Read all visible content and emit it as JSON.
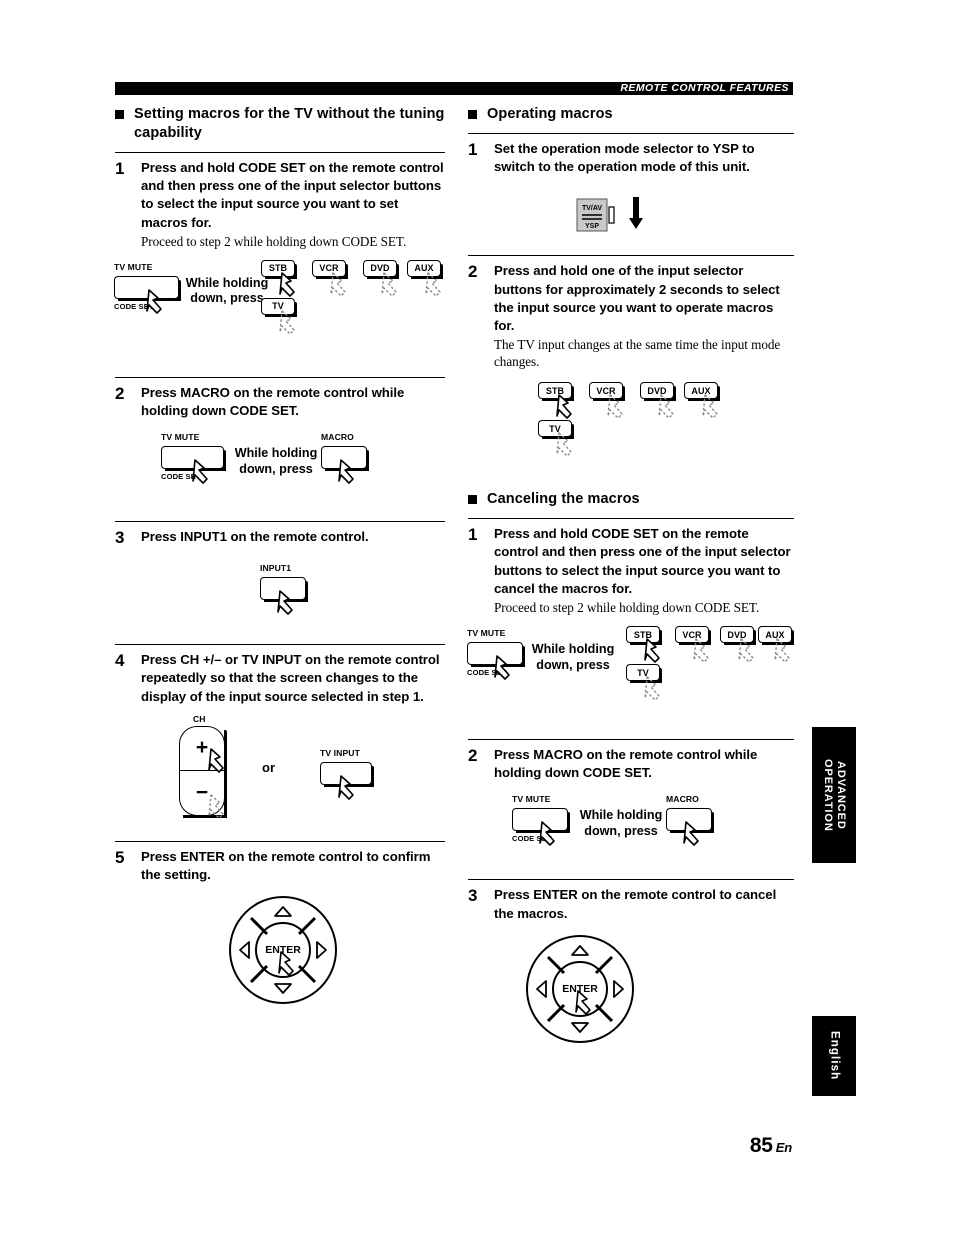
{
  "header": {
    "running_title": "REMOTE CONTROL FEATURES"
  },
  "labels": {
    "while_holding_line1": "While holding",
    "while_holding_line2": "down, press",
    "or": "or",
    "tv_mute": "TV MUTE",
    "code_set": "CODE SET",
    "macro": "MACRO",
    "input1": "INPUT1",
    "ch": "CH",
    "plus": "+",
    "minus": "−",
    "tv_input": "TV INPUT",
    "enter": "ENTER",
    "selector_top": "TV/AV",
    "selector_bottom": "YSP"
  },
  "input_buttons": [
    "STB",
    "VCR",
    "DVD",
    "AUX"
  ],
  "tv_button": "TV",
  "left_column": {
    "section_title": "Setting macros for the TV without the tuning capability",
    "steps": [
      {
        "num": "1",
        "main": "Press and hold CODE SET on the remote control and then press one of the input selector buttons to select the input source you want to set macros for.",
        "sub": "Proceed to step 2 while holding down CODE SET."
      },
      {
        "num": "2",
        "main": "Press MACRO on the remote control while holding down CODE SET.",
        "sub": ""
      },
      {
        "num": "3",
        "main": "Press INPUT1 on the remote control.",
        "sub": ""
      },
      {
        "num": "4",
        "main": "Press CH +/– or TV INPUT on the remote control repeatedly so that the screen changes to the display of the input source selected in step 1.",
        "sub": ""
      },
      {
        "num": "5",
        "main": "Press ENTER on the remote control to confirm the setting.",
        "sub": ""
      }
    ]
  },
  "right_column": {
    "sections": [
      {
        "section_title": "Operating macros",
        "steps": [
          {
            "num": "1",
            "main": "Set the operation mode selector to YSP to switch to the operation mode of this unit.",
            "sub": ""
          },
          {
            "num": "2",
            "main": "Press and hold one of the input selector buttons for approximately 2 seconds to select the input source you want to operate macros for.",
            "sub": "The TV input changes at the same time the input mode changes."
          }
        ]
      },
      {
        "section_title": "Canceling the macros",
        "steps": [
          {
            "num": "1",
            "main": "Press and hold CODE SET on the remote control and then press one of the input selector buttons to select the input source you want to cancel the macros for.",
            "sub": "Proceed to step 2 while holding down CODE SET."
          },
          {
            "num": "2",
            "main": "Press MACRO on the remote control while holding down CODE SET.",
            "sub": ""
          },
          {
            "num": "3",
            "main": "Press ENTER on the remote control to cancel the macros.",
            "sub": ""
          }
        ]
      }
    ]
  },
  "side_tabs": {
    "advanced": "ADVANCED OPERATION",
    "language": "English"
  },
  "footer": {
    "page_number": "85",
    "page_suffix": "En"
  }
}
